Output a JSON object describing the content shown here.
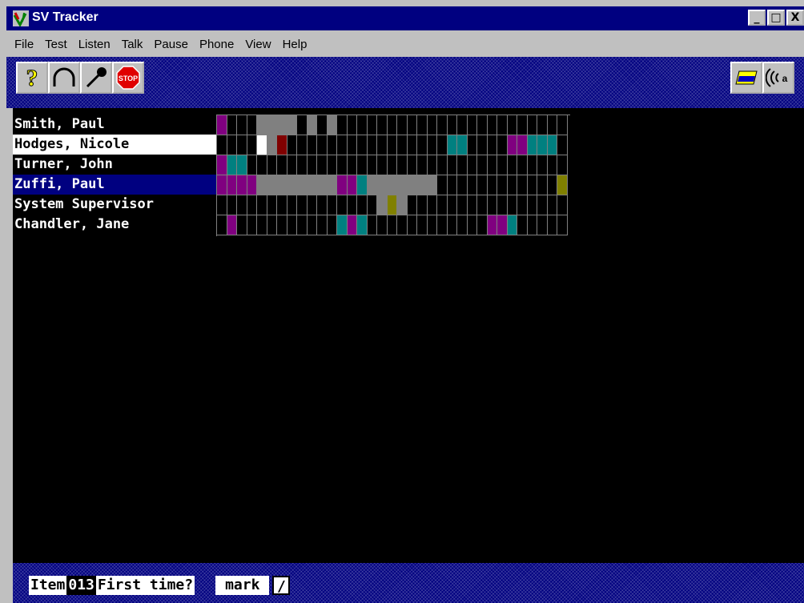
{
  "window": {
    "title": "SV Tracker",
    "app_icon": "sv-tracker-logo-icon"
  },
  "window_controls": {
    "minimize": "_",
    "maximize": "□",
    "close": "X"
  },
  "menu": [
    "File",
    "Test",
    "Listen",
    "Talk",
    "Pause",
    "Phone",
    "View",
    "Help"
  ],
  "toolbar": {
    "left": [
      "help-icon",
      "headphones-icon",
      "microphone-icon",
      "stop-icon"
    ],
    "stop_label": "STOP",
    "right": [
      "card-icon",
      "speaker-icon"
    ]
  },
  "users": [
    {
      "name": "Smith, Paul",
      "selected": "none"
    },
    {
      "name": "Hodges, Nicole",
      "selected": "white"
    },
    {
      "name": "Turner, John",
      "selected": "none"
    },
    {
      "name": "Zuffi, Paul",
      "selected": "blue"
    },
    {
      "name": "System Supervisor",
      "selected": "none"
    },
    {
      "name": "Chandler, Jane",
      "selected": "none"
    }
  ],
  "timeline": {
    "columns": 35,
    "legend_colors": {
      "P": "#800080",
      "G": "#808080",
      "W": "#ffffff",
      "R": "#800000",
      "T": "#008080",
      "Y": "#808000",
      "B": "#000000"
    },
    "rows": [
      "PBBBGGGGBGBGBBBBBBBBBBBBBBBBBBBBBBB",
      "BBBBWGRBBBBBBBBBBBBBBBBTTBBBBPPTTTBB",
      "PTTBBBBBBBBBBBBBBBBBBBBBBBBBBBBBBBB",
      "PPPPGGGGGGGGPPTGGGGGGGBBBBBBBBBBBBY",
      "BBBBBBBBBBBBBBBBGYGBBBBBBBBBBBBBBBB",
      "BPBBBBBBBBBBTPTBBBBBBBBBBBBPPTBBBBB"
    ]
  },
  "status": {
    "item_label": "Item",
    "item_number": "013",
    "prompt": "First time?",
    "mark_label": "mark",
    "mark_value": "/"
  }
}
